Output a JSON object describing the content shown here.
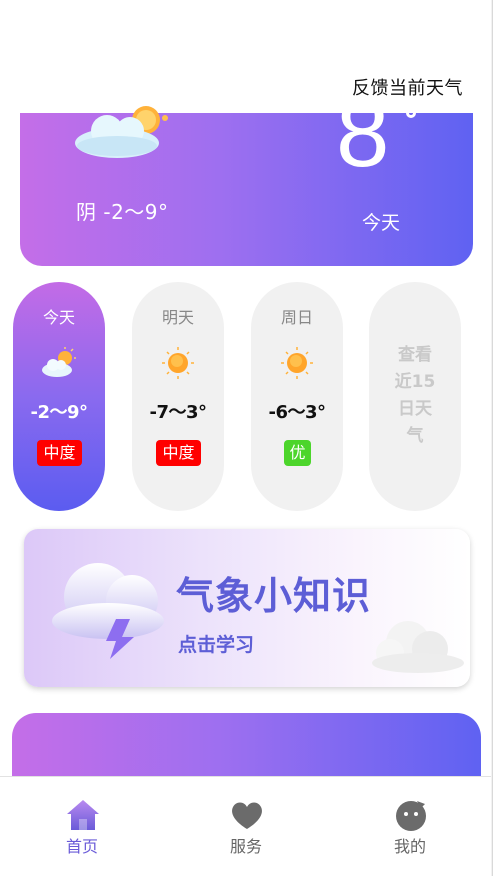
{
  "header": {
    "feedback_label": "反馈当前天气"
  },
  "today": {
    "weather": "阴",
    "range_text": "阴 -2～9°",
    "current_temp": "8",
    "label": "今天"
  },
  "forecast": [
    {
      "day": "今天",
      "temps": "-2～9°",
      "aqi": "中度",
      "aqi_color": "#ff0000",
      "icon": "cloudy-sun-icon",
      "active": true
    },
    {
      "day": "明天",
      "temps": "-7～3°",
      "aqi": "中度",
      "aqi_color": "#ff0000",
      "icon": "sunny-icon",
      "active": false
    },
    {
      "day": "周日",
      "temps": "-6～3°",
      "aqi": "优",
      "aqi_color": "#4cd52b",
      "icon": "sunny-icon",
      "active": false
    }
  ],
  "more_days": {
    "label": "查看近15日天气"
  },
  "knowledge": {
    "title": "气象小知识",
    "link": "点击学习"
  },
  "tabbar": [
    {
      "label": "首页",
      "icon": "home-icon",
      "active": true
    },
    {
      "label": "服务",
      "icon": "heart-icon",
      "active": false
    },
    {
      "label": "我的",
      "icon": "profile-icon",
      "active": false
    }
  ],
  "colors": {
    "accent": "#6a5bd8",
    "gradient_start": "#c46ee8",
    "gradient_end": "#5f62f2",
    "aqi_moderate": "#ff0000",
    "aqi_good": "#4cd52b"
  }
}
